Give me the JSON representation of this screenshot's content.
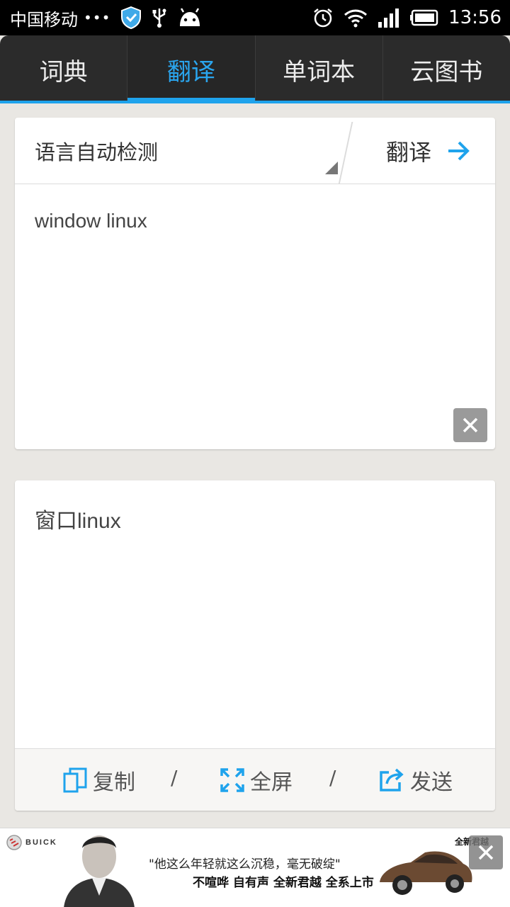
{
  "status_bar": {
    "carrier": "中国移动",
    "dots": "•••",
    "time": "13:56",
    "icons": [
      "shield-icon",
      "usb-icon",
      "android-icon",
      "alarm-icon",
      "wifi-icon",
      "signal-icon",
      "battery-icon"
    ]
  },
  "tabs": [
    {
      "label": "词典",
      "active": false
    },
    {
      "label": "翻译",
      "active": true
    },
    {
      "label": "单词本",
      "active": false
    },
    {
      "label": "云图书",
      "active": false
    }
  ],
  "input_card": {
    "language_select": "语言自动检测",
    "translate_label": "翻译",
    "input_text": "window linux"
  },
  "output_card": {
    "result_text": "窗口linux",
    "actions": {
      "copy": "复制",
      "fullscreen": "全屏",
      "send": "发送",
      "separator": "/"
    }
  },
  "ad": {
    "brand": "BUICK",
    "line1": "\"他这么年轻就这么沉稳，毫无破绽\"",
    "line2": "不喧哗 自有声 全新君越 全系上市",
    "tag": "全新君越"
  },
  "colors": {
    "accent": "#1fa3ec",
    "tabbar": "#2b2b2b",
    "background": "#e9e7e3"
  }
}
